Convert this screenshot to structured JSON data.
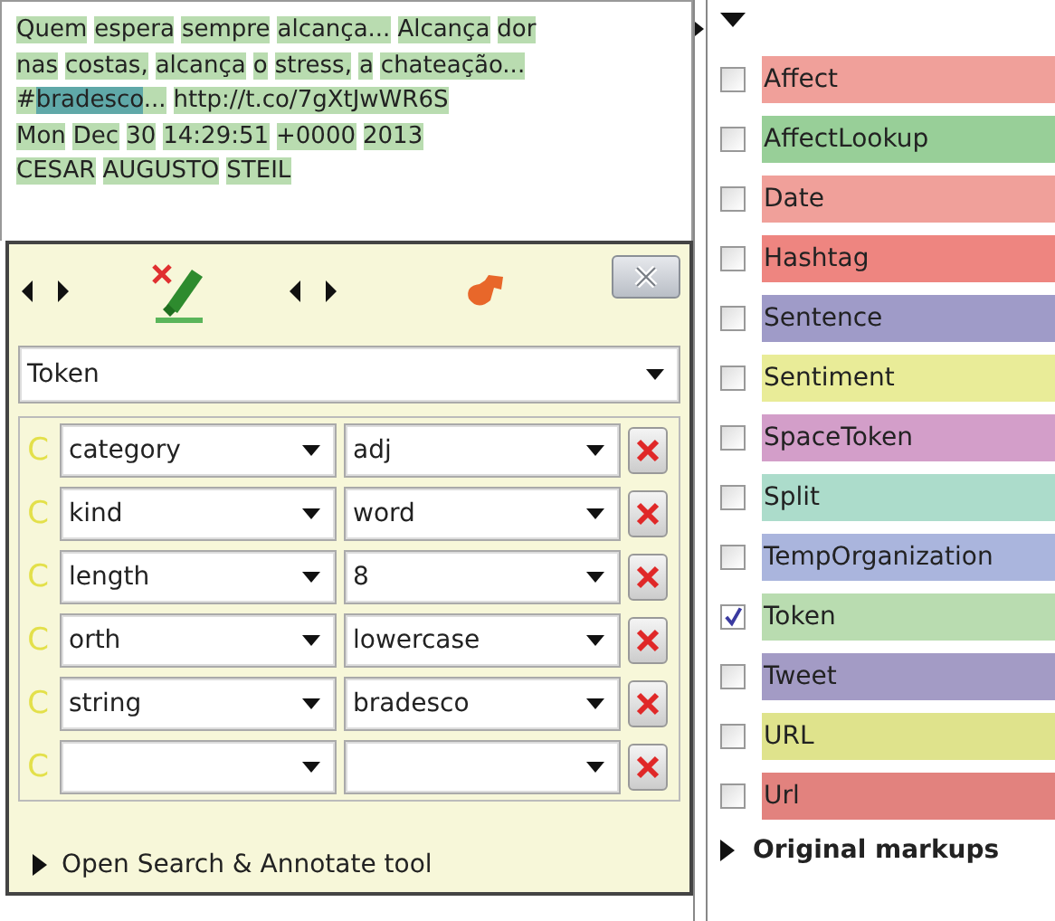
{
  "document": {
    "lines": [
      [
        [
          {
            "text": "Quem",
            "selected": false
          }
        ],
        [
          {
            "text": "espera",
            "selected": false
          }
        ],
        [
          {
            "text": "sempre",
            "selected": false
          }
        ],
        [
          {
            "text": "alcança...",
            "selected": false
          }
        ],
        [
          {
            "text": "Alcança",
            "selected": false
          }
        ],
        [
          {
            "text": "dor",
            "selected": false
          }
        ]
      ],
      [
        [
          {
            "text": "nas",
            "selected": false
          }
        ],
        [
          {
            "text": "costas,",
            "selected": false
          }
        ],
        [
          {
            "text": "alcança",
            "selected": false
          }
        ],
        [
          {
            "text": "o",
            "selected": false
          }
        ],
        [
          {
            "text": "stress,",
            "selected": false
          }
        ],
        [
          {
            "text": "a",
            "selected": false
          }
        ],
        [
          {
            "text": "chateação...",
            "selected": false
          }
        ]
      ],
      [
        [
          {
            "text": "#",
            "selected": false
          },
          {
            "text": "bradesco",
            "selected": true
          },
          {
            "text": "...",
            "selected": false
          }
        ],
        [
          {
            "text": "http://t.co/7gXtJwWR6S",
            "selected": false
          }
        ]
      ],
      [
        [
          {
            "text": "Mon",
            "selected": false
          }
        ],
        [
          {
            "text": "Dec",
            "selected": false
          }
        ],
        [
          {
            "text": "30",
            "selected": false
          }
        ],
        [
          {
            "text": "14:29:51",
            "selected": false
          }
        ],
        [
          {
            "text": "+0000",
            "selected": false
          }
        ],
        [
          {
            "text": "2013",
            "selected": false
          }
        ]
      ],
      [
        [
          {
            "text": "CESAR",
            "selected": false
          }
        ],
        [
          {
            "text": "AUGUSTO",
            "selected": false
          }
        ],
        [
          {
            "text": "STEIL",
            "selected": false
          }
        ]
      ]
    ]
  },
  "editor": {
    "type": "Token",
    "features": [
      {
        "marker": "C",
        "name": "category",
        "value": "adj"
      },
      {
        "marker": "C",
        "name": "kind",
        "value": "word"
      },
      {
        "marker": "C",
        "name": "length",
        "value": "8"
      },
      {
        "marker": "C",
        "name": "orth",
        "value": "lowercase"
      },
      {
        "marker": "C",
        "name": "string",
        "value": "bradesco"
      },
      {
        "marker": "C"
      }
    ],
    "search_tool": "Open Search & Annotate tool"
  },
  "annotation_sets": {
    "types": [
      {
        "label": "Affect",
        "checked": false,
        "color": "#f0a09a"
      },
      {
        "label": "AffectLookup",
        "checked": false,
        "color": "#98cf98"
      },
      {
        "label": "Date",
        "checked": false,
        "color": "#f0a09a"
      },
      {
        "label": "Hashtag",
        "checked": false,
        "color": "#ee8580"
      },
      {
        "label": "Sentence",
        "checked": false,
        "color": "#9f9bc8"
      },
      {
        "label": "Sentiment",
        "checked": false,
        "color": "#e9ec98"
      },
      {
        "label": "SpaceToken",
        "checked": false,
        "color": "#d39ec9"
      },
      {
        "label": "Split",
        "checked": false,
        "color": "#acdccb"
      },
      {
        "label": "TempOrganization",
        "checked": false,
        "color": "#aab5dd"
      },
      {
        "label": "Token",
        "checked": true,
        "color": "#b9dcb0"
      },
      {
        "label": "Tweet",
        "checked": false,
        "color": "#a39bc5"
      },
      {
        "label": "URL",
        "checked": false,
        "color": "#dfe38c"
      },
      {
        "label": "Url",
        "checked": false,
        "color": "#e2827e"
      }
    ],
    "original_markups": "Original markups"
  }
}
